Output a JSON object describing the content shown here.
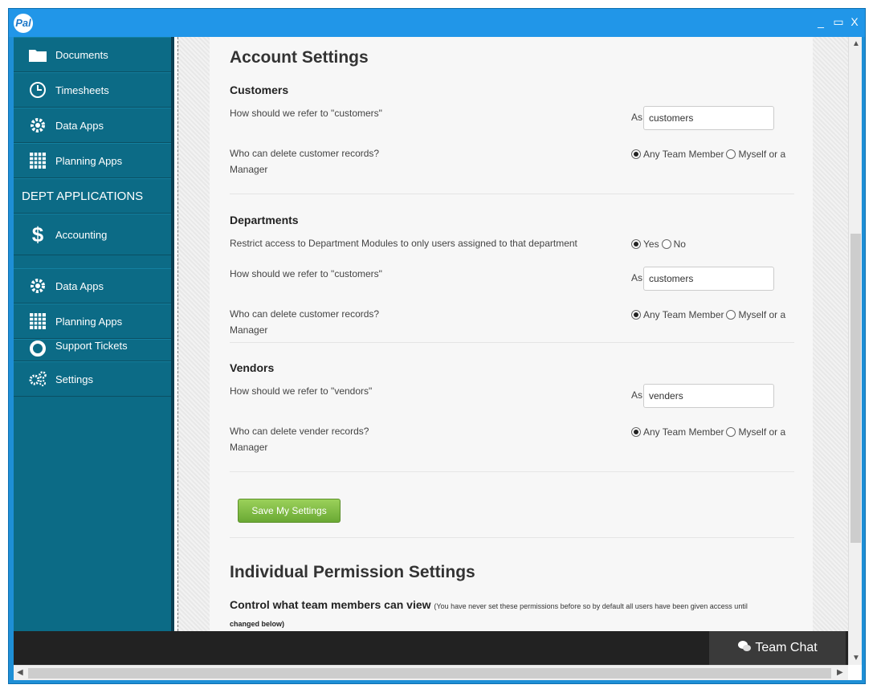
{
  "window": {
    "logo": "Pal",
    "min": "_",
    "max": "▭",
    "close": "X"
  },
  "sidebar": {
    "items": [
      {
        "label": "Documents",
        "icon": "folder-icon"
      },
      {
        "label": "Timesheets",
        "icon": "clock-icon"
      },
      {
        "label": "Data Apps",
        "icon": "gear-icon"
      },
      {
        "label": "Planning Apps",
        "icon": "calendar-icon"
      }
    ],
    "section": "DEPT APPLICATIONS",
    "dept_items": [
      {
        "label": "Accounting",
        "icon": "dollar-icon"
      },
      {
        "label": "Data Apps",
        "icon": "gear-icon"
      },
      {
        "label": "Planning Apps",
        "icon": "calendar-icon"
      },
      {
        "label": "Support Tickets",
        "icon": "lifebuoy-icon"
      },
      {
        "label": "Settings",
        "icon": "gears-icon"
      }
    ]
  },
  "content": {
    "title": "Account Settings",
    "customers": {
      "heading": "Customers",
      "refer_label": "How should we refer to \"customers\"",
      "as": "As",
      "refer_value": "customers",
      "delete_label_1": "Who can delete customer records?",
      "delete_label_2": "Manager",
      "opt1": "Any Team Member",
      "opt2": "Myself or a"
    },
    "departments": {
      "heading": "Departments",
      "restrict_label": "Restrict access to Department Modules to only users assigned to that department",
      "yes": "Yes",
      "no": "No",
      "refer_label": "How should we refer to \"customers\"",
      "as": "As",
      "refer_value": "customers",
      "delete_label_1": "Who can delete customer records?",
      "delete_label_2": "Manager",
      "opt1": "Any Team Member",
      "opt2": "Myself or a"
    },
    "vendors": {
      "heading": "Vendors",
      "refer_label": "How should we refer to \"vendors\"",
      "as": "As",
      "refer_value": "venders",
      "delete_label_1": "Who can delete vender records?",
      "delete_label_2": "Manager",
      "opt1": "Any Team Member",
      "opt2": "Myself or a"
    },
    "save_label": "Save My Settings",
    "perm_title": "Individual Permission Settings",
    "control_heading": "Control what team members can view",
    "control_note_1": "(You have never set these permissions before so by default all users have been given access until",
    "control_note_2": "changed below)"
  },
  "footer": {
    "team_chat": "Team Chat"
  },
  "colors": {
    "sidebar": "#0c6b86",
    "titlebar": "#2196e8",
    "save_button": "#7fbf45"
  }
}
